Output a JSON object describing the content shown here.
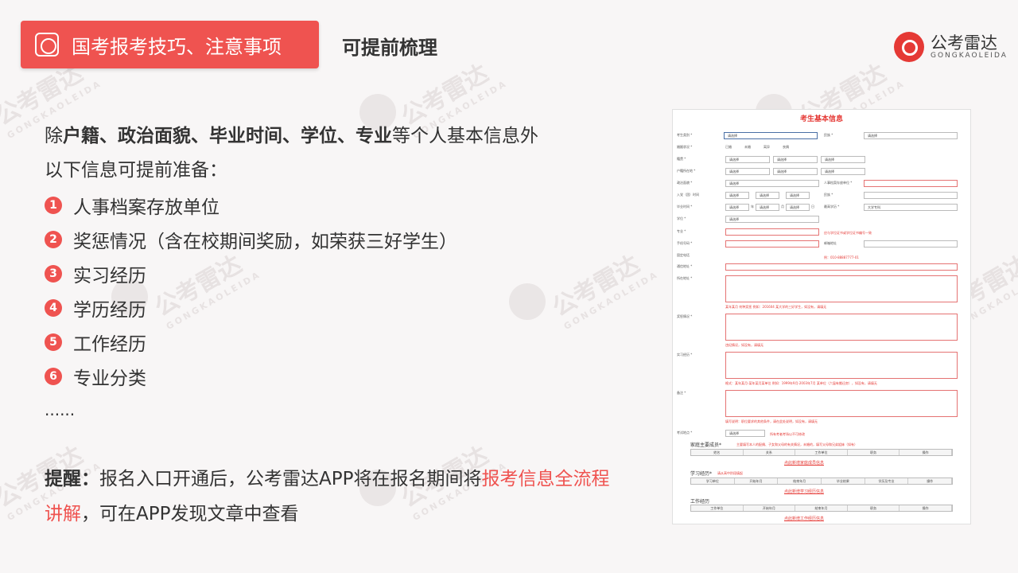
{
  "header": {
    "tag_label": "国考报考技巧、注意事项",
    "subtitle": "可提前梳理",
    "brand_name": "公考雷达",
    "brand_pinyin": "GONGKAOLEIDA"
  },
  "watermark": {
    "text": "公考雷达",
    "pinyin": "GONGKAOLEIDA"
  },
  "intro": {
    "prefix": "除",
    "bold": "户籍、政治面貌、毕业时间、学位、专业",
    "suffix": "等个人基本信息外",
    "line2": "以下信息可提前准备："
  },
  "items": [
    {
      "num": "1",
      "label": "人事档案存放单位"
    },
    {
      "num": "2",
      "label": "奖惩情况（含在校期间奖励，如荣获三好学生）"
    },
    {
      "num": "3",
      "label": "实习经历"
    },
    {
      "num": "4",
      "label": "学历经历"
    },
    {
      "num": "5",
      "label": "工作经历"
    },
    {
      "num": "6",
      "label": "专业分类"
    }
  ],
  "ellipsis": "......",
  "reminder": {
    "label": "提醒：",
    "text1": "报名入口开通后，公考雷达APP将在报名期间将",
    "highlight1": "报考信息全流程",
    "highlight2": "讲解",
    "text2": "，可在APP发现文章中查看"
  },
  "form": {
    "title": "考生基本信息",
    "select_placeholder": "请选择",
    "labels": [
      "考生类别 *",
      "婚姻状况 *",
      "籍贯 *",
      "户籍所在地 *",
      "政治面貌 *",
      "入党（团）时间",
      "毕业时间 *",
      "学位 *",
      "专业 *",
      "手机号码 *",
      "固定电话",
      "通信地址 *",
      "所在地址 *",
      "奖惩情况 *",
      "实习经历 *",
      "备注 *",
      "考试地点 *"
    ],
    "right_labels": [
      "民族 *",
      "人事档案存放单位 *",
      "民族 *",
      "最高学历 *",
      "邮箱地址"
    ],
    "right_values": [
      "请选择",
      "大学专科"
    ],
    "marital": [
      "已婚",
      "未婚",
      "离异",
      "丧偶"
    ],
    "notes": [
      "应与学位证书或学位证书编号一致",
      "例：010-88887777-01",
      "某年某月 何种奖惩 例如：201604 某大学的三好学生，如没有，请填无",
      "违纪情况，如没有，请填无",
      "格式：某年某月-某年某月某单位 例如：1999年9月-2003年7月 某单位（六届有搬迁房），如没有，请填无",
      "填写说明：职位要求的其他条件，请在此处说明，如没有，请填无",
      "所有考者考场以不可修改"
    ],
    "family_head": "家庭主要成员*",
    "family_note": "主要填写本人的配偶、子女和父母的有关情况，未婚的，填写父母和兄弟姐妹（如有）",
    "family_cols": [
      "姓名",
      "关系",
      "工作单位",
      "职务",
      "操作"
    ],
    "family_link": "点此新增家庭成员信息",
    "study_head": "学习经历*",
    "study_note": "请从高中阶段填起",
    "study_cols": [
      "学习单位",
      "开始年月",
      "结束年月",
      "毕业结果",
      "学历及专业",
      "操作"
    ],
    "study_link": "点此新增学习经历信息",
    "work_head": "工作经历",
    "work_cols": [
      "工作单位",
      "开始年月",
      "结束年月",
      "职务",
      "操作"
    ],
    "work_link": "点此新增工作经历信息",
    "time_units": [
      "年",
      "月",
      "日"
    ]
  },
  "colors": {
    "accent": "#ef5350",
    "text": "#333333",
    "background": "#f8f6f6"
  }
}
